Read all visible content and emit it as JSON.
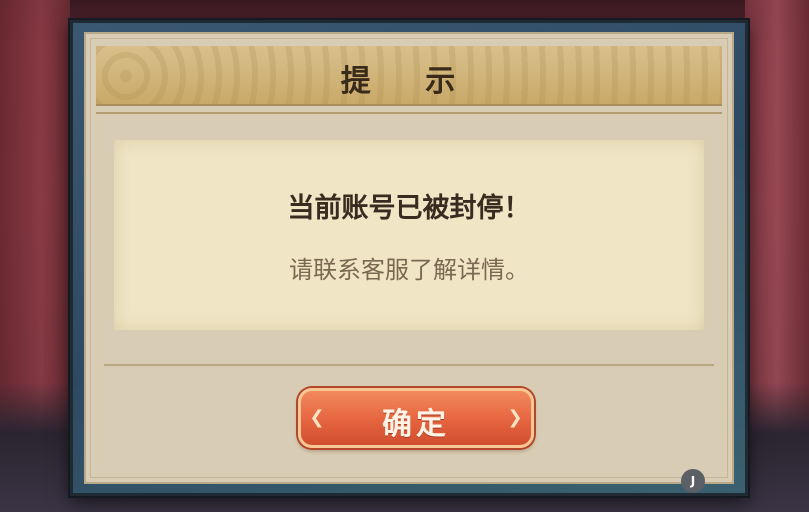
{
  "dialog": {
    "title": "提 示",
    "message_main": "当前账号已被封停！",
    "message_sub": "请联系客服了解详情。",
    "confirm_label": "确定"
  },
  "corner_badge": "J",
  "colors": {
    "panel": "#d8cdb4",
    "paper": "#f0e6c6",
    "button": "#e6643f",
    "frame": "#2e4a63"
  }
}
